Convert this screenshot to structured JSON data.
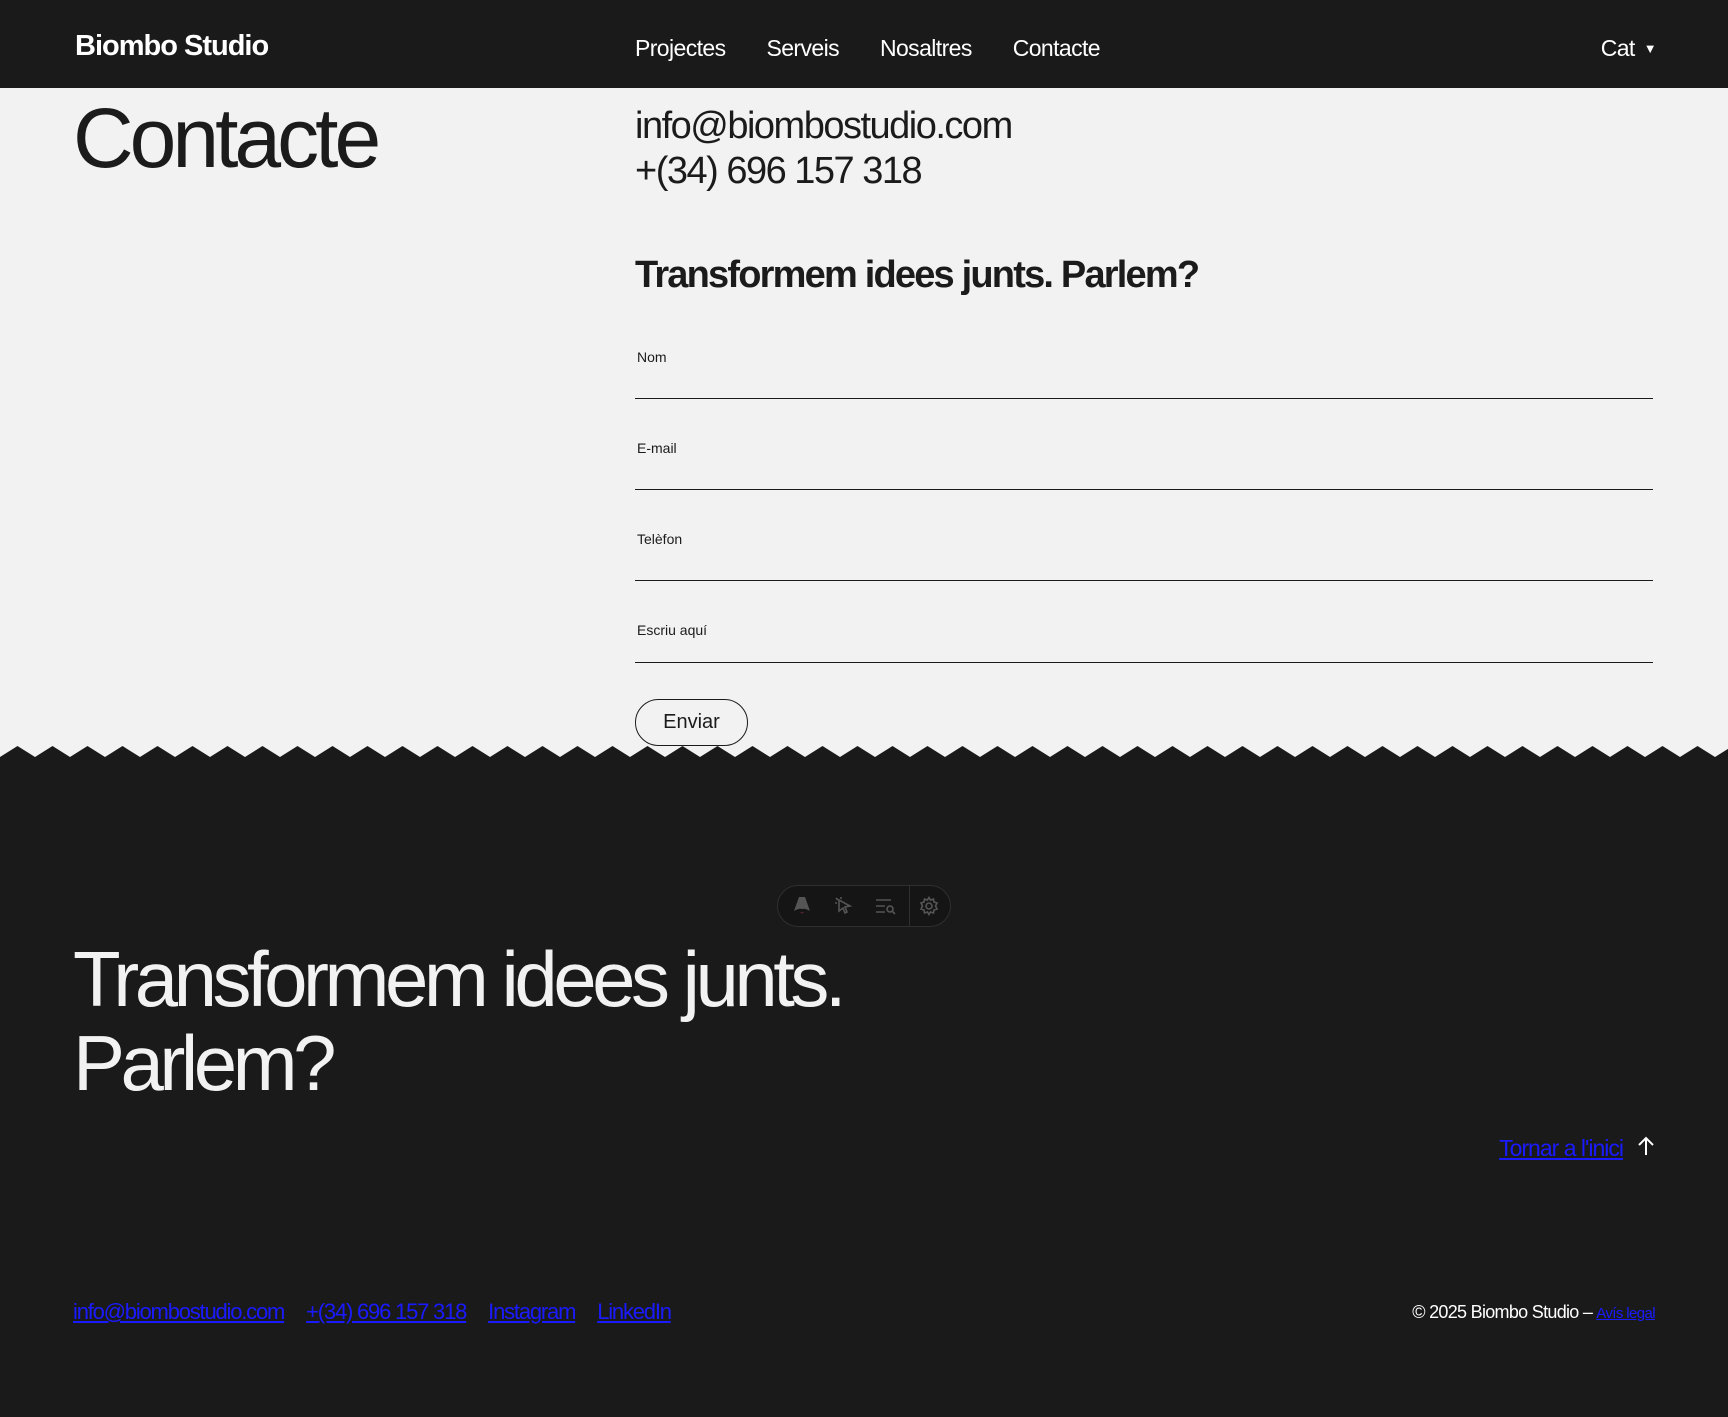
{
  "header": {
    "logo": "Biombo Studio",
    "nav": [
      "Projectes",
      "Serveis",
      "Nosaltres",
      "Contacte"
    ],
    "language": "Cat"
  },
  "contact": {
    "title": "Contacte",
    "email": "info@biombostudio.com",
    "phone": "+(34) 696 157 318",
    "form_heading": "Transformem idees junts. Parlem?",
    "fields": {
      "name_label": "Nom",
      "email_label": "E-mail",
      "phone_label": "Telèfon",
      "message_label": "Escriu aquí"
    },
    "submit_label": "Enviar"
  },
  "footer": {
    "cta_line1": "Transformem idees junts.",
    "cta_line2": "Parlem?",
    "back_to_top": "Tornar a l'inici",
    "links": [
      "info@biombostudio.com",
      "+(34) 696 157 318",
      "Instagram",
      "LinkedIn"
    ],
    "copyright": "© 2025 Biombo Studio –",
    "legal": "Avís legal"
  },
  "toolbar": {
    "icons": [
      "astro-logo-icon",
      "inspect-cursor-icon",
      "audit-list-icon",
      "settings-gear-icon"
    ]
  },
  "colors": {
    "dark": "#1a1a1a",
    "light": "#f2f2f2",
    "link": "#1a1aff"
  }
}
